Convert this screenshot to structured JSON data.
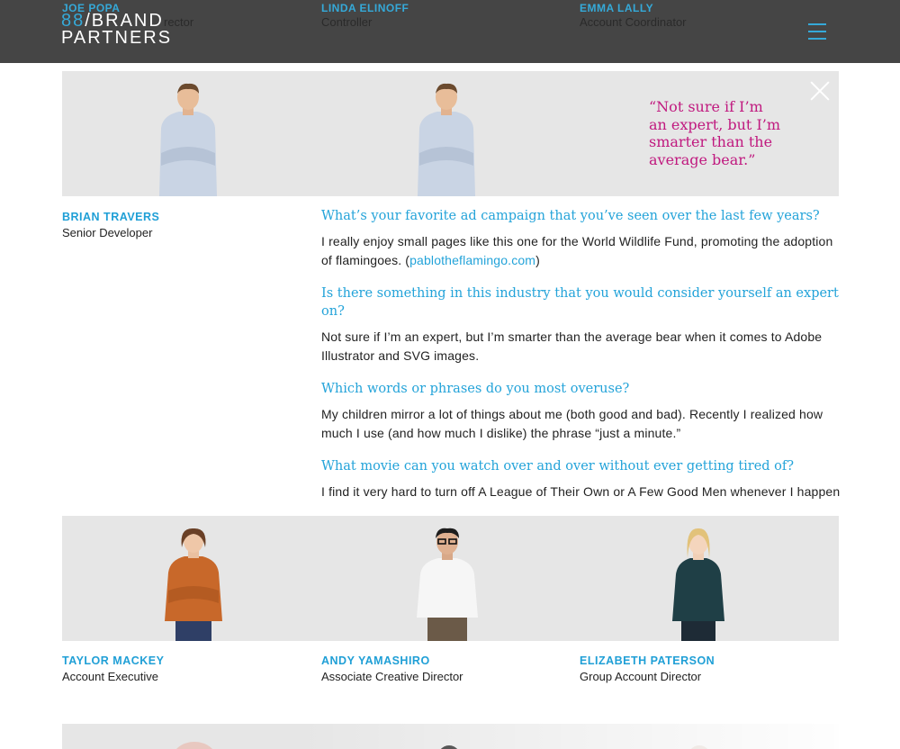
{
  "header": {
    "logo_accent": "88",
    "logo_line1": "/BRAND",
    "logo_line2": "PARTNERS",
    "top_people": [
      {
        "name": "JOE POPA",
        "role": "rector"
      },
      {
        "name": "LINDA ELINOFF",
        "role": "Controller"
      },
      {
        "name": "EMMA LALLY",
        "role": "Account Coordinator"
      }
    ],
    "accent_color": "#35a9d8"
  },
  "featured": {
    "name": "BRIAN TRAVERS",
    "role": "Senior Developer",
    "quote": "“Not sure if I’m an expert, but I’m smarter than the average bear.”",
    "quote_color": "#c0197f"
  },
  "qa": [
    {
      "question": "What’s your favorite ad campaign that you’ve seen over the last few years?",
      "answer": "I really enjoy small pages like this one for the World Wildlife Fund, promoting the adoption of flamingoes. (",
      "link": "pablotheflamingo.com",
      "answer_end": ")"
    },
    {
      "question": "Is there something in this industry that you would consider yourself an expert on?",
      "answer": "Not sure if I’m an expert, but I’m smarter than the average bear when it comes to Adobe Illustrator and SVG images."
    },
    {
      "question": "Which words or phrases do you most overuse?",
      "answer": "My children mirror a lot of things about me (both good and bad). Recently I realized how much I use (and how much I dislike) the phrase “just a minute.”"
    },
    {
      "question": "What movie can you watch over and over without ever getting tired of?",
      "answer": "I find it very hard to turn off A League of Their Own or A Few Good Men whenever I happen upon them channel surfing (when that was a thing)."
    }
  ],
  "team": [
    {
      "name": "TAYLOR MACKEY",
      "role": "Account Executive"
    },
    {
      "name": "ANDY YAMASHIRO",
      "role": "Associate Creative Director"
    },
    {
      "name": "ELIZABETH PATERSON",
      "role": "Group Account Director"
    }
  ]
}
